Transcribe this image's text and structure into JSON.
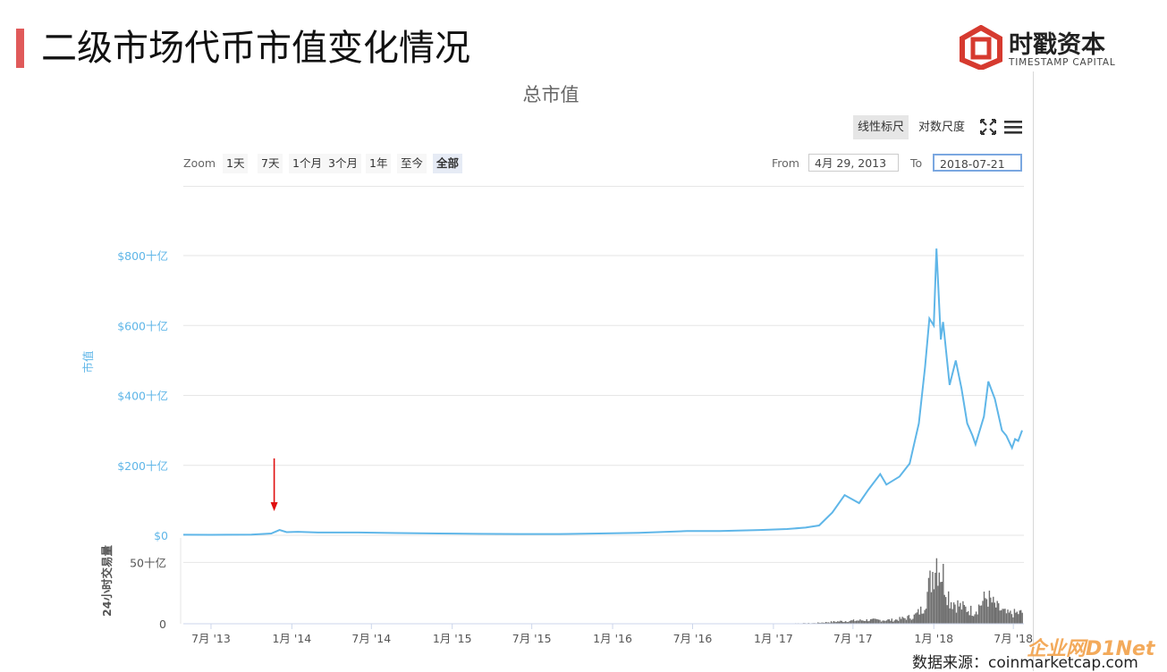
{
  "slide": {
    "title": "二级市场代币市值变化情况"
  },
  "logo": {
    "name": "时戳资本",
    "sub": "TIMESTAMP CAPITAL"
  },
  "toolbar": {
    "scale_linear": "线性标尺",
    "scale_log": "对数尺度",
    "zoom_label": "Zoom",
    "zoom_options": [
      "1天",
      "7天",
      "1个月",
      "3个月",
      "1年",
      "至今",
      "全部"
    ],
    "zoom_active": "全部",
    "from_label": "From",
    "from_value": "4月 29, 2013",
    "to_label": "To",
    "to_value": "2018-07-21"
  },
  "footer": {
    "source": "数据来源：coinmarketcap.com",
    "watermark": "企业网D1Net"
  },
  "colors": {
    "series": "#5fb6e8",
    "volume": "#6e6e6e",
    "accent": "#e05a5a",
    "arrow": "#e01010"
  },
  "icons": {
    "expand": "expand-arrows-icon",
    "menu": "hamburger-menu-icon",
    "logo": "timestamp-capital-logo-icon",
    "arrow": "red-down-arrow-icon"
  },
  "chart_data": {
    "type": "line",
    "title": "总市值",
    "ylabel": "市值",
    "y_ticks": [
      "$0",
      "$200十亿",
      "$400十亿",
      "$600十亿",
      "$800十亿"
    ],
    "y_tick_values": [
      0,
      200,
      400,
      600,
      800
    ],
    "ylim": [
      0,
      800
    ],
    "unit": "十亿美元",
    "x_ticks": [
      "7月 '13",
      "1月 '14",
      "7月 '14",
      "1月 '15",
      "7月 '15",
      "1月 '16",
      "7月 '16",
      "1月 '17",
      "7月 '17",
      "1月 '18",
      "7月 '18"
    ],
    "x_tick_dates": [
      "2013-07-01",
      "2014-01-01",
      "2014-07-01",
      "2015-01-01",
      "2015-07-01",
      "2016-01-01",
      "2016-07-01",
      "2017-01-01",
      "2017-07-01",
      "2018-01-01",
      "2018-07-01"
    ],
    "xlim": [
      "2013-04-29",
      "2018-07-21"
    ],
    "grid": true,
    "series": [
      {
        "x": [
          "2013-04-29",
          "2013-07-01",
          "2013-10-01",
          "2013-11-15",
          "2013-12-04",
          "2013-12-20",
          "2014-01-15",
          "2014-03-01",
          "2014-06-01",
          "2014-09-01",
          "2014-12-01",
          "2015-03-01",
          "2015-06-01",
          "2015-09-01",
          "2015-12-01",
          "2016-03-01",
          "2016-06-18",
          "2016-09-01",
          "2016-12-01",
          "2017-02-01",
          "2017-03-15",
          "2017-04-15",
          "2017-05-15",
          "2017-06-12",
          "2017-07-15",
          "2017-08-05",
          "2017-09-01",
          "2017-09-15",
          "2017-10-15",
          "2017-11-07",
          "2017-11-28",
          "2017-12-12",
          "2017-12-22",
          "2018-01-01",
          "2018-01-07",
          "2018-01-17",
          "2018-01-22",
          "2018-02-06",
          "2018-02-20",
          "2018-03-05",
          "2018-03-18",
          "2018-03-30",
          "2018-04-06",
          "2018-04-25",
          "2018-05-05",
          "2018-05-20",
          "2018-06-05",
          "2018-06-15",
          "2018-06-28",
          "2018-07-05",
          "2018-07-12",
          "2018-07-21"
        ],
        "y": [
          1.5,
          1.2,
          2,
          5,
          15,
          9,
          10,
          8,
          8,
          6.5,
          5,
          4,
          3.5,
          3.5,
          5,
          7,
          12,
          12,
          15,
          18,
          22,
          28,
          65,
          115,
          92,
          130,
          175,
          145,
          168,
          205,
          320,
          480,
          620,
          600,
          820,
          560,
          610,
          430,
          500,
          420,
          320,
          285,
          260,
          340,
          440,
          390,
          300,
          285,
          250,
          275,
          270,
          300
        ]
      }
    ],
    "volume": {
      "label": "24小时交易量",
      "y_ticks": [
        "0",
        "50十亿"
      ],
      "y_tick_values": [
        0,
        50
      ],
      "x": [
        "2013-04-29",
        "2016-12-01",
        "2017-04-01",
        "2017-06-01",
        "2017-08-01",
        "2017-10-01",
        "2017-11-15",
        "2017-12-05",
        "2017-12-20",
        "2018-01-05",
        "2018-01-20",
        "2018-02-05",
        "2018-03-01",
        "2018-04-01",
        "2018-05-01",
        "2018-05-20",
        "2018-06-15",
        "2018-07-21"
      ],
      "y": [
        0,
        0.1,
        0.5,
        2,
        3,
        3,
        6,
        12,
        30,
        55,
        40,
        20,
        14,
        10,
        22,
        14,
        8,
        9
      ]
    },
    "annotations": [
      {
        "type": "arrow",
        "date": "2013-12-04",
        "note": "red arrow pointing at late-2013 peak"
      }
    ]
  }
}
